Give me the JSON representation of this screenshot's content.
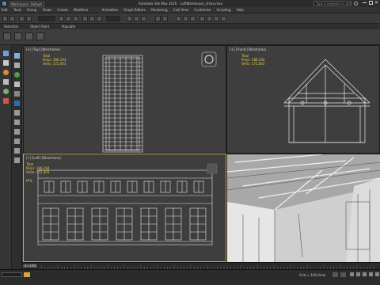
{
  "titlebar": {
    "workspace": "Workspace: Default",
    "app_title": "Autodesk 3ds Max 2016",
    "filename": "LoftWarehouse_2max.max",
    "search_placeholder": "Type a keyword or phrase"
  },
  "menu": {
    "items": [
      "Edit",
      "Tools",
      "Group",
      "Views",
      "Create",
      "Modifiers",
      "Animation",
      "Graph Editors",
      "Rendering",
      "Civil View",
      "Customize",
      "Scripting",
      "Help"
    ]
  },
  "ribbon": {
    "tabs": [
      "Selection",
      "Object Paint",
      "Populate"
    ]
  },
  "viewports": {
    "top": {
      "label": "[+] [Top] [Wireframe]",
      "stats_total": "Total",
      "stats_polys": "Polys: 386,194",
      "stats_verts": "Verts: 172,003"
    },
    "front": {
      "label": "[+] [Front] [Wireframe]",
      "stats_total": "Total",
      "stats_polys": "Polys: 386,194",
      "stats_verts": "Verts: 172,003"
    },
    "left": {
      "label": "[+] [Left] [Wireframe]",
      "stats_total": "Total",
      "stats_polys": "Polys: 386,194",
      "stats_verts": "Verts: 172,003",
      "fps": "FPS:"
    },
    "perspective": {
      "label": ""
    }
  },
  "status": {
    "frame_counter": "0 / 100",
    "grid": "Grid = 100,0mm",
    "welcome": ""
  },
  "colors": {
    "active_border": "#c9a64a",
    "stats_text": "#e6c84a",
    "wire": "#e8e8e8"
  }
}
